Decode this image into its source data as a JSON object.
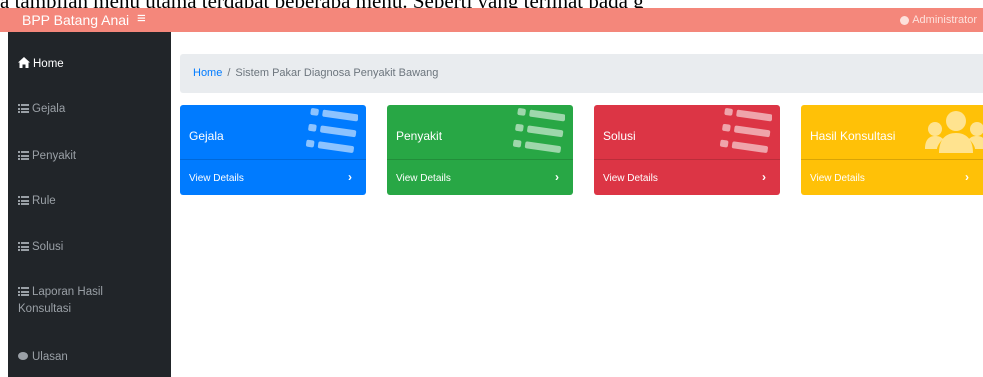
{
  "doc_caption": "a tampilan menu utama terdapat beberapa menu. Seperti yang terlihat pada g",
  "topbar": {
    "brand": "BPP Batang Anai",
    "toggle_glyph": "≡",
    "user_label": "Administrator",
    "color": "#f4877b"
  },
  "sidebar": {
    "items": [
      {
        "label": "Home",
        "icon": "home-icon"
      },
      {
        "label": "Gejala",
        "icon": "list-icon"
      },
      {
        "label": "Penyakit",
        "icon": "list-icon"
      },
      {
        "label": "Rule",
        "icon": "list-icon"
      },
      {
        "label": "Solusi",
        "icon": "list-icon"
      },
      {
        "label": "Laporan Hasil Konsultasi",
        "icon": "list-icon"
      },
      {
        "label": "Ulasan",
        "icon": "comment-icon"
      }
    ]
  },
  "breadcrumb": {
    "home": "Home",
    "separator": "/",
    "current": "Sistem Pakar Diagnosa Penyakit Bawang"
  },
  "cards": [
    {
      "title": "Gejala",
      "link": "View Details",
      "chevron": "›",
      "color": "#007bff",
      "icon": "list-icon"
    },
    {
      "title": "Penyakit",
      "link": "View Details",
      "chevron": "›",
      "color": "#28a745",
      "icon": "list-icon"
    },
    {
      "title": "Solusi",
      "link": "View Details",
      "chevron": "›",
      "color": "#dc3545",
      "icon": "list-icon"
    },
    {
      "title": "Hasil Konsultasi",
      "link": "View Details",
      "chevron": "›",
      "color": "#ffc107",
      "icon": "users-icon"
    }
  ]
}
